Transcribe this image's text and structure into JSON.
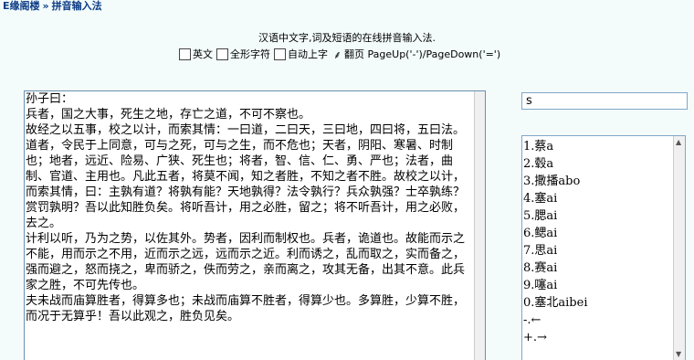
{
  "breadcrumb": {
    "site": "E缘阁楼",
    "separator": "»",
    "page": "拼音输入法"
  },
  "subtitle": "汉语中文字,词及短语的在线拼音输入法.",
  "options": {
    "english": "英文",
    "fullwidth": "全形字符",
    "auto_commit": "自动上字",
    "page_hint_icon": "⸙",
    "page_hint": "翻页 PageUp('-')/PageDown('=')"
  },
  "editor": {
    "text": "孙子曰：\n兵者，国之大事，死生之地，存亡之道，不可不察也。\n故经之以五事，校之以计，而索其情：一曰道，二曰天，三曰地，四曰将，五曰法。道者，令民于上同意，可与之死，可与之生，而不危也；天者，阴阳、寒暑、时制也；地者，远近、险易、广狭、死生也；将者，智、信、仁、勇、严也；法者，曲制、官道、主用也。凡此五者，将莫不闻，知之者胜，不知之者不胜。故校之以计，而索其情，曰：主孰有道？将孰有能？天地孰得？法令孰行？兵众孰强？士卒孰练？赏罚孰明？吾以此知胜负矣。将听吾计，用之必胜，留之；将不听吾计，用之必败，去之。\n计利以听，乃为之势，以佐其外。势者，因利而制权也。兵者，诡道也。故能而示之不能，用而示之不用，近而示之远，远而示之近。利而诱之，乱而取之，实而备之，强而避之，怒而挠之，卑而骄之，佚而劳之，亲而离之，攻其无备，出其不意。此兵家之胜，不可先传也。\n夫未战而庙算胜者，得算多也；未战而庙算不胜者，得算少也。多算胜，少算不胜，而况于无算乎！吾以此观之，胜负见矣。"
  },
  "pinyin_input": {
    "value": "s"
  },
  "candidates": [
    "1.蔡a",
    "2.毂a",
    "3.撒播abo",
    "4.塞ai",
    "5.腮ai",
    "6.鳃ai",
    "7.思ai",
    "8.赛ai",
    "9.噻ai",
    "0.塞北aibei",
    "-.←",
    "+.→"
  ]
}
